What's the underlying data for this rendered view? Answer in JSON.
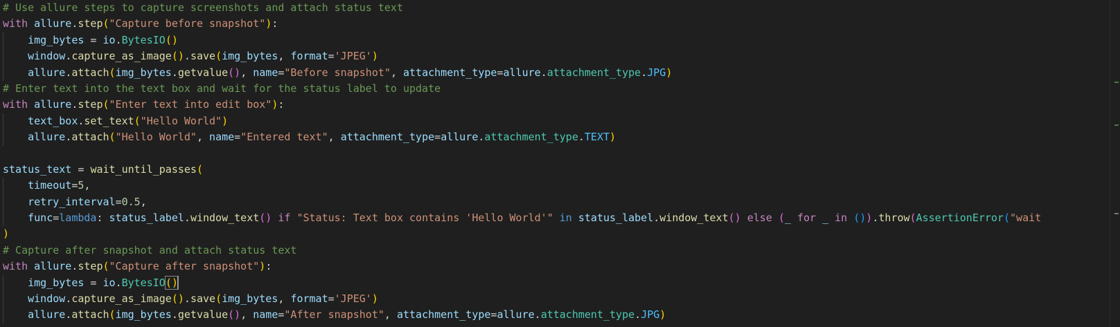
{
  "editor": {
    "lines": [
      [
        [
          "comment",
          "# Use allure steps to capture screenshots and attach status text"
        ]
      ],
      [
        [
          "keyword",
          "with "
        ],
        [
          "var",
          "allure"
        ],
        [
          "op",
          "."
        ],
        [
          "func",
          "step"
        ],
        [
          "b1",
          "("
        ],
        [
          "string",
          "\"Capture before snapshot\""
        ],
        [
          "b1",
          ")"
        ],
        [
          "op",
          ":"
        ]
      ],
      [
        [
          "op",
          "    "
        ],
        [
          "var",
          "img_bytes"
        ],
        [
          "op",
          " = "
        ],
        [
          "var",
          "io"
        ],
        [
          "op",
          "."
        ],
        [
          "class",
          "BytesIO"
        ],
        [
          "b1",
          "()"
        ]
      ],
      [
        [
          "op",
          "    "
        ],
        [
          "var",
          "window"
        ],
        [
          "op",
          "."
        ],
        [
          "func",
          "capture_as_image"
        ],
        [
          "b1",
          "()"
        ],
        [
          "op",
          "."
        ],
        [
          "func",
          "save"
        ],
        [
          "b1",
          "("
        ],
        [
          "var",
          "img_bytes"
        ],
        [
          "op",
          ", "
        ],
        [
          "var",
          "format"
        ],
        [
          "op",
          "="
        ],
        [
          "string",
          "'JPEG'"
        ],
        [
          "b1",
          ")"
        ]
      ],
      [
        [
          "op",
          "    "
        ],
        [
          "var",
          "allure"
        ],
        [
          "op",
          "."
        ],
        [
          "func",
          "attach"
        ],
        [
          "b1",
          "("
        ],
        [
          "var",
          "img_bytes"
        ],
        [
          "op",
          "."
        ],
        [
          "func",
          "getvalue"
        ],
        [
          "b2",
          "()"
        ],
        [
          "op",
          ", "
        ],
        [
          "var",
          "name"
        ],
        [
          "op",
          "="
        ],
        [
          "string",
          "\"Before snapshot\""
        ],
        [
          "op",
          ", "
        ],
        [
          "var",
          "attachment_type"
        ],
        [
          "op",
          "="
        ],
        [
          "var",
          "allure"
        ],
        [
          "op",
          "."
        ],
        [
          "class",
          "attachment_type"
        ],
        [
          "op",
          "."
        ],
        [
          "const",
          "JPG"
        ],
        [
          "b1",
          ")"
        ]
      ],
      [
        [
          "comment",
          "# Enter text into the text box and wait for the status label to update"
        ]
      ],
      [
        [
          "keyword",
          "with "
        ],
        [
          "var",
          "allure"
        ],
        [
          "op",
          "."
        ],
        [
          "func",
          "step"
        ],
        [
          "b1",
          "("
        ],
        [
          "string",
          "\"Enter text into edit box\""
        ],
        [
          "b1",
          ")"
        ],
        [
          "op",
          ":"
        ]
      ],
      [
        [
          "op",
          "    "
        ],
        [
          "var",
          "text_box"
        ],
        [
          "op",
          "."
        ],
        [
          "func",
          "set_text"
        ],
        [
          "b1",
          "("
        ],
        [
          "string",
          "\"Hello World\""
        ],
        [
          "b1",
          ")"
        ]
      ],
      [
        [
          "op",
          "    "
        ],
        [
          "var",
          "allure"
        ],
        [
          "op",
          "."
        ],
        [
          "func",
          "attach"
        ],
        [
          "b1",
          "("
        ],
        [
          "string",
          "\"Hello World\""
        ],
        [
          "op",
          ", "
        ],
        [
          "var",
          "name"
        ],
        [
          "op",
          "="
        ],
        [
          "string",
          "\"Entered text\""
        ],
        [
          "op",
          ", "
        ],
        [
          "var",
          "attachment_type"
        ],
        [
          "op",
          "="
        ],
        [
          "var",
          "allure"
        ],
        [
          "op",
          "."
        ],
        [
          "class",
          "attachment_type"
        ],
        [
          "op",
          "."
        ],
        [
          "const",
          "TEXT"
        ],
        [
          "b1",
          ")"
        ]
      ],
      [],
      [
        [
          "var",
          "status_text"
        ],
        [
          "op",
          " = "
        ],
        [
          "func",
          "wait_until_passes"
        ],
        [
          "b1",
          "("
        ]
      ],
      [
        [
          "op",
          "    "
        ],
        [
          "var",
          "timeout"
        ],
        [
          "op",
          "="
        ],
        [
          "number",
          "5"
        ],
        [
          "op",
          ","
        ]
      ],
      [
        [
          "op",
          "    "
        ],
        [
          "var",
          "retry_interval"
        ],
        [
          "op",
          "="
        ],
        [
          "number",
          "0.5"
        ],
        [
          "op",
          ","
        ]
      ],
      [
        [
          "op",
          "    "
        ],
        [
          "var",
          "func"
        ],
        [
          "op",
          "="
        ],
        [
          "decl",
          "lambda"
        ],
        [
          "op",
          ": "
        ],
        [
          "var",
          "status_label"
        ],
        [
          "op",
          "."
        ],
        [
          "func",
          "window_text"
        ],
        [
          "b2",
          "()"
        ],
        [
          "op",
          " "
        ],
        [
          "keyword",
          "if"
        ],
        [
          "op",
          " "
        ],
        [
          "string",
          "\"Status: Text box contains 'Hello World'\""
        ],
        [
          "op",
          " "
        ],
        [
          "decl",
          "in"
        ],
        [
          "op",
          " "
        ],
        [
          "var",
          "status_label"
        ],
        [
          "op",
          "."
        ],
        [
          "func",
          "window_text"
        ],
        [
          "b2",
          "()"
        ],
        [
          "op",
          " "
        ],
        [
          "keyword",
          "else"
        ],
        [
          "op",
          " "
        ],
        [
          "b2",
          "("
        ],
        [
          "var",
          "_"
        ],
        [
          "op",
          " "
        ],
        [
          "keyword",
          "for"
        ],
        [
          "op",
          " "
        ],
        [
          "var",
          "_"
        ],
        [
          "op",
          " "
        ],
        [
          "keyword",
          "in"
        ],
        [
          "op",
          " "
        ],
        [
          "b3",
          "()"
        ],
        [
          "b2",
          ")"
        ],
        [
          "op",
          "."
        ],
        [
          "func",
          "throw"
        ],
        [
          "b2",
          "("
        ],
        [
          "class",
          "AssertionError"
        ],
        [
          "b3",
          "("
        ],
        [
          "string",
          "\"wait"
        ]
      ],
      [
        [
          "b1",
          ")"
        ]
      ],
      [
        [
          "comment",
          "# Capture after snapshot and attach status text"
        ]
      ],
      [
        [
          "keyword",
          "with "
        ],
        [
          "var",
          "allure"
        ],
        [
          "op",
          "."
        ],
        [
          "func",
          "step"
        ],
        [
          "b1",
          "("
        ],
        [
          "string",
          "\"Capture after snapshot\""
        ],
        [
          "b1",
          ")"
        ],
        [
          "op",
          ":"
        ]
      ],
      [
        [
          "op",
          "    "
        ],
        [
          "var",
          "img_bytes"
        ],
        [
          "op",
          " = "
        ],
        [
          "var",
          "io"
        ],
        [
          "op",
          "."
        ],
        [
          "class",
          "BytesIO"
        ],
        [
          "b1m",
          "()"
        ],
        [
          "cursor",
          ""
        ]
      ],
      [
        [
          "op",
          "    "
        ],
        [
          "var",
          "window"
        ],
        [
          "op",
          "."
        ],
        [
          "func",
          "capture_as_image"
        ],
        [
          "b1",
          "()"
        ],
        [
          "op",
          "."
        ],
        [
          "func",
          "save"
        ],
        [
          "b1",
          "("
        ],
        [
          "var",
          "img_bytes"
        ],
        [
          "op",
          ", "
        ],
        [
          "var",
          "format"
        ],
        [
          "op",
          "="
        ],
        [
          "string",
          "'JPEG'"
        ],
        [
          "b1",
          ")"
        ]
      ],
      [
        [
          "op",
          "    "
        ],
        [
          "var",
          "allure"
        ],
        [
          "op",
          "."
        ],
        [
          "func",
          "attach"
        ],
        [
          "b1",
          "("
        ],
        [
          "var",
          "img_bytes"
        ],
        [
          "op",
          "."
        ],
        [
          "func",
          "getvalue"
        ],
        [
          "b2",
          "()"
        ],
        [
          "op",
          ", "
        ],
        [
          "var",
          "name"
        ],
        [
          "op",
          "="
        ],
        [
          "string",
          "\"After snapshot\""
        ],
        [
          "op",
          ", "
        ],
        [
          "var",
          "attachment_type"
        ],
        [
          "op",
          "="
        ],
        [
          "var",
          "allure"
        ],
        [
          "op",
          "."
        ],
        [
          "class",
          "attachment_type"
        ],
        [
          "op",
          "."
        ],
        [
          "const",
          "JPG"
        ],
        [
          "b1",
          ")"
        ]
      ]
    ],
    "indented_lines": [
      2,
      3,
      4,
      7,
      8,
      11,
      12,
      13,
      17,
      18,
      19
    ],
    "colors": {
      "background": "#1f1f1f",
      "comment": "#6a9955",
      "keyword": "#c586c0",
      "string": "#ce9178",
      "function": "#dcdcaa",
      "variable": "#9cdcfe",
      "class": "#4ec9b0"
    }
  }
}
